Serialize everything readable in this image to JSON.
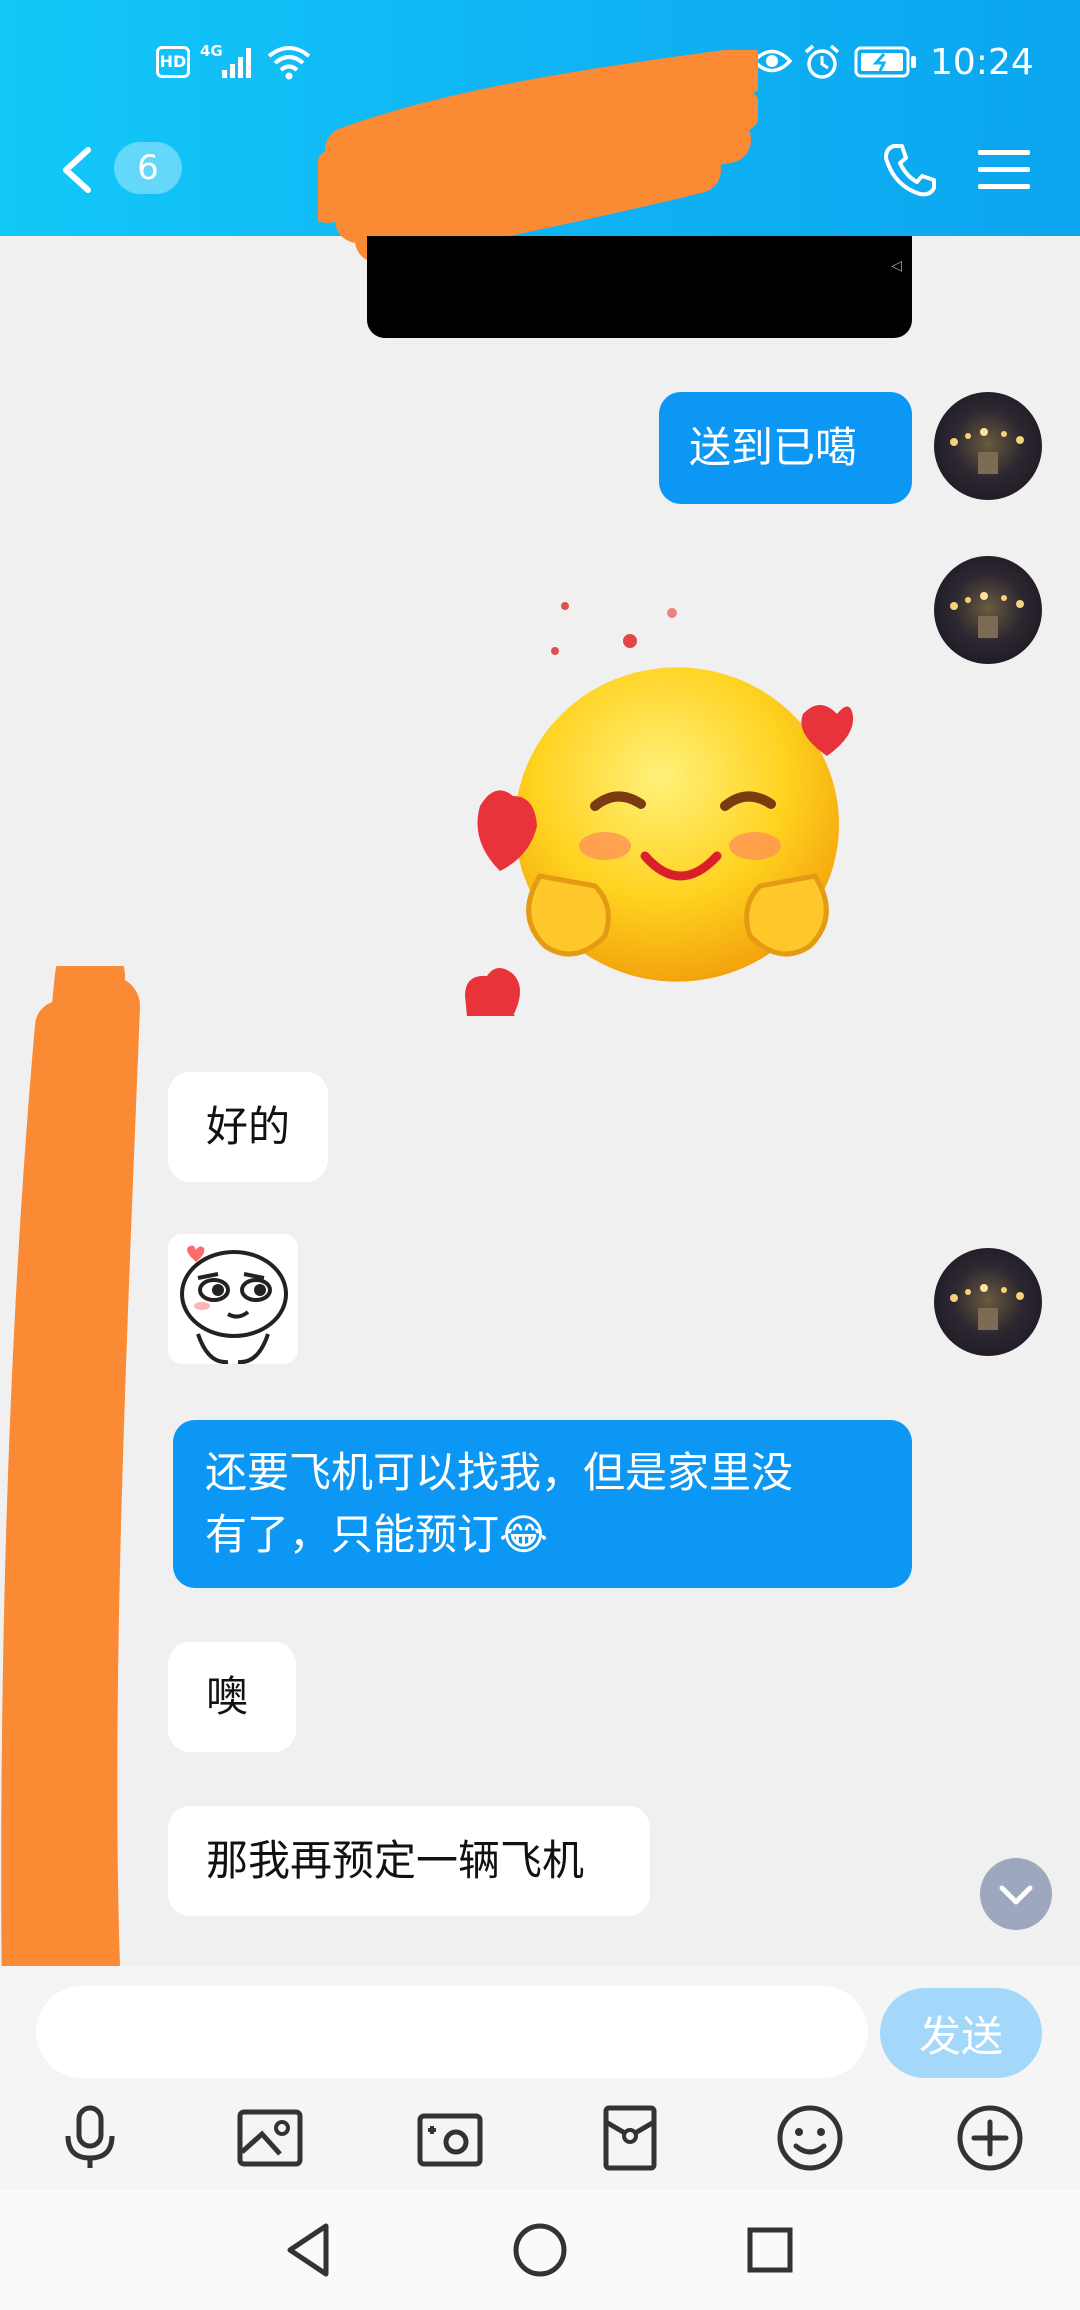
{
  "status_bar": {
    "time": "10:24",
    "network": "4G",
    "hd": "HD"
  },
  "header": {
    "unread_count": "6",
    "title": ""
  },
  "messages": [
    {
      "type": "text",
      "side": "out",
      "text": "送到已噶"
    },
    {
      "type": "sticker",
      "side": "out",
      "sticker": "blushing-hearts-emoji"
    },
    {
      "type": "text",
      "side": "in",
      "text": "好的"
    },
    {
      "type": "sticker",
      "side": "in",
      "sticker": "smirk-face-meme"
    },
    {
      "type": "text",
      "side": "out",
      "lines": [
        "还要飞机可以找我，但是家里没",
        "有了，只能预订😂"
      ]
    },
    {
      "type": "text",
      "side": "in",
      "text": "噢"
    },
    {
      "type": "text",
      "side": "in",
      "text": "那我再预定一辆飞机"
    }
  ],
  "input": {
    "placeholder": "",
    "send_label": "发送"
  },
  "toolbar": [
    "microphone-icon",
    "image-icon",
    "camera-icon",
    "red-packet-icon",
    "emoji-icon",
    "plus-icon"
  ],
  "colors": {
    "header": "#10b4f4",
    "outgoing_bubble": "#0c97f5",
    "send_button": "#a3d8fb",
    "redaction": "#fb8a34"
  }
}
